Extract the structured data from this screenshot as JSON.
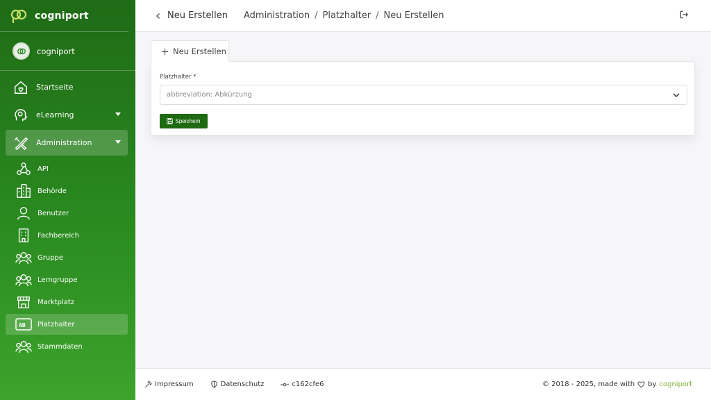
{
  "app": {
    "brand": "cogniport",
    "accent": "#2a8a20",
    "button_color": "#1e6a12"
  },
  "user": {
    "name": "cogniport"
  },
  "sidebar": {
    "items": [
      {
        "label": "Startseite",
        "icon": "home-icon"
      },
      {
        "label": "eLearning",
        "icon": "brain-icon"
      },
      {
        "label": "Administration",
        "icon": "tools-icon"
      }
    ],
    "sub_items": [
      {
        "label": "API",
        "icon": "webhook-icon"
      },
      {
        "label": "Behörde",
        "icon": "buildings-icon"
      },
      {
        "label": "Benutzer",
        "icon": "user-icon"
      },
      {
        "label": "Fachbereich",
        "icon": "building-icon"
      },
      {
        "label": "Gruppe",
        "icon": "users-group-icon"
      },
      {
        "label": "Lerngruppe",
        "icon": "users-group-icon"
      },
      {
        "label": "Marktplatz",
        "icon": "store-icon"
      },
      {
        "label": "Platzhalter",
        "icon": "ab-icon"
      },
      {
        "label": "Stammdaten",
        "icon": "users-group-icon"
      }
    ]
  },
  "header": {
    "title": "Neu Erstellen",
    "breadcrumb": [
      "Administration",
      "Platzhalter",
      "Neu Erstellen"
    ],
    "separator": "/"
  },
  "tab": {
    "label": "Neu Erstellen"
  },
  "form": {
    "field_label": "Platzhalter *",
    "select_value": "abbreviation: Abkürzung",
    "save_label": "Speichern"
  },
  "footer": {
    "impressum": "Impressum",
    "datenschutz": "Datenschutz",
    "commit": "c162cfe6",
    "copyright": "© 2018 - 2025, made with",
    "by": "by",
    "brand": "cogniport"
  }
}
